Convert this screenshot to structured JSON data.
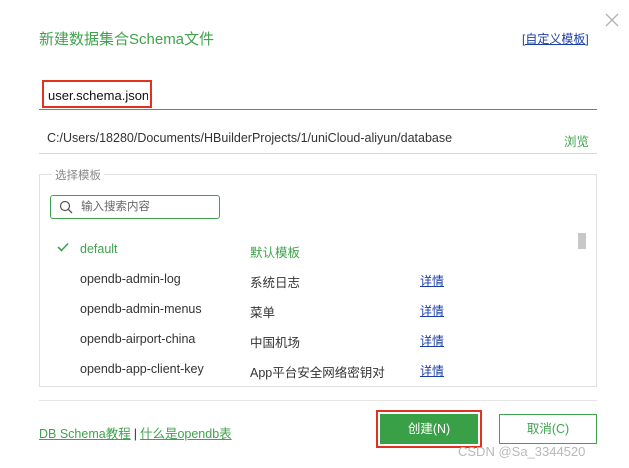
{
  "dialog": {
    "title": "新建数据集合Schema文件",
    "custom_template_link": "[自定义模板]",
    "close_icon": "close-icon"
  },
  "file": {
    "name_value": "user.schema.json",
    "path": "C:/Users/18280/Documents/HBuilderProjects/1/uniCloud-aliyun/database",
    "browse_label": "浏览"
  },
  "templates": {
    "legend": "选择模板",
    "search_placeholder": "输入搜索内容",
    "items": [
      {
        "name": "default",
        "desc": "默认模板",
        "detail": "",
        "selected": true
      },
      {
        "name": "opendb-admin-log",
        "desc": "系统日志",
        "detail": "详情",
        "selected": false
      },
      {
        "name": "opendb-admin-menus",
        "desc": "菜单",
        "detail": "详情",
        "selected": false
      },
      {
        "name": "opendb-airport-china",
        "desc": "中国机场",
        "detail": "详情",
        "selected": false
      },
      {
        "name": "opendb-app-client-key",
        "desc": "App平台安全网络密钥对",
        "detail": "详情",
        "selected": false
      }
    ]
  },
  "footer": {
    "tutorial_link": "DB Schema教程",
    "separator": "|",
    "opendb_link": "什么是opendb表",
    "create_label": "创建(N)",
    "cancel_label": "取消(C)"
  },
  "watermark": "CSDN @Sa_3344520",
  "colors": {
    "accent": "#3fa34d",
    "link": "#1a3ea8",
    "highlight": "#e0321f"
  }
}
